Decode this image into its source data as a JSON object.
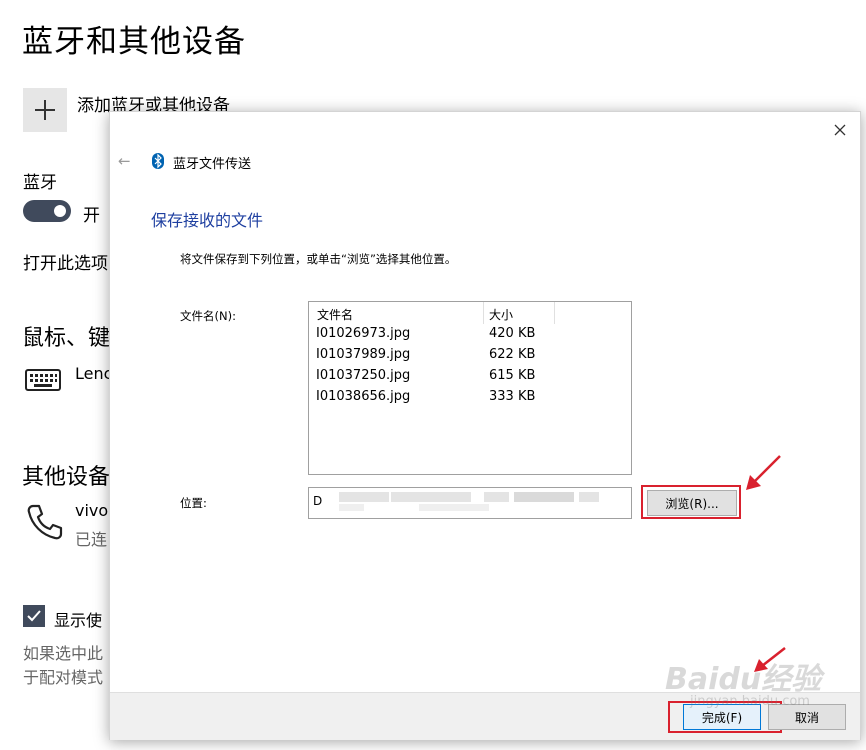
{
  "settings": {
    "title": "蓝牙和其他设备",
    "add_device_label": "添加蓝牙或其他设备",
    "bluetooth_label": "蓝牙",
    "toggle_state": "开",
    "open_option_text": "打开此选项",
    "mouse_section": "鼠标、键",
    "keyboard_device": "Lenc",
    "other_section": "其他设备",
    "phone_name": "vivo",
    "phone_status": "已连",
    "show_checkbox_label": "显示使",
    "description_line1": "如果选中此",
    "description_line2": "于配对模式"
  },
  "dialog": {
    "title": "蓝牙文件传送",
    "section_title": "保存接收的文件",
    "instruction": "将文件保存到下列位置，或单击“浏览”选择其他位置。",
    "files_label": "文件名(N):",
    "columns": [
      "文件名",
      "大小"
    ],
    "files": [
      {
        "name": "I01026973.jpg",
        "size": "420 KB"
      },
      {
        "name": "I01037989.jpg",
        "size": "622 KB"
      },
      {
        "name": "I01037250.jpg",
        "size": "615 KB"
      },
      {
        "name": "I01038656.jpg",
        "size": "333 KB"
      }
    ],
    "location_label": "位置:",
    "location_value": "D",
    "browse_label": "浏览(R)...",
    "finish_label": "完成(F)",
    "cancel_label": "取消"
  },
  "watermark": {
    "text": "Baidu经验",
    "sub": "jingyan.baidu.com"
  },
  "colors": {
    "accent": "#0078d7",
    "toggle_on": "#404a5c",
    "section_title": "#1e3fa0",
    "annotation_red": "#d9212e"
  },
  "icons": {
    "add": "plus-icon",
    "keyboard": "keyboard-icon",
    "phone": "phone-icon",
    "bluetooth": "bluetooth-icon",
    "close": "close-icon",
    "back": "back-arrow-icon",
    "checkbox": "checkmark-icon"
  }
}
